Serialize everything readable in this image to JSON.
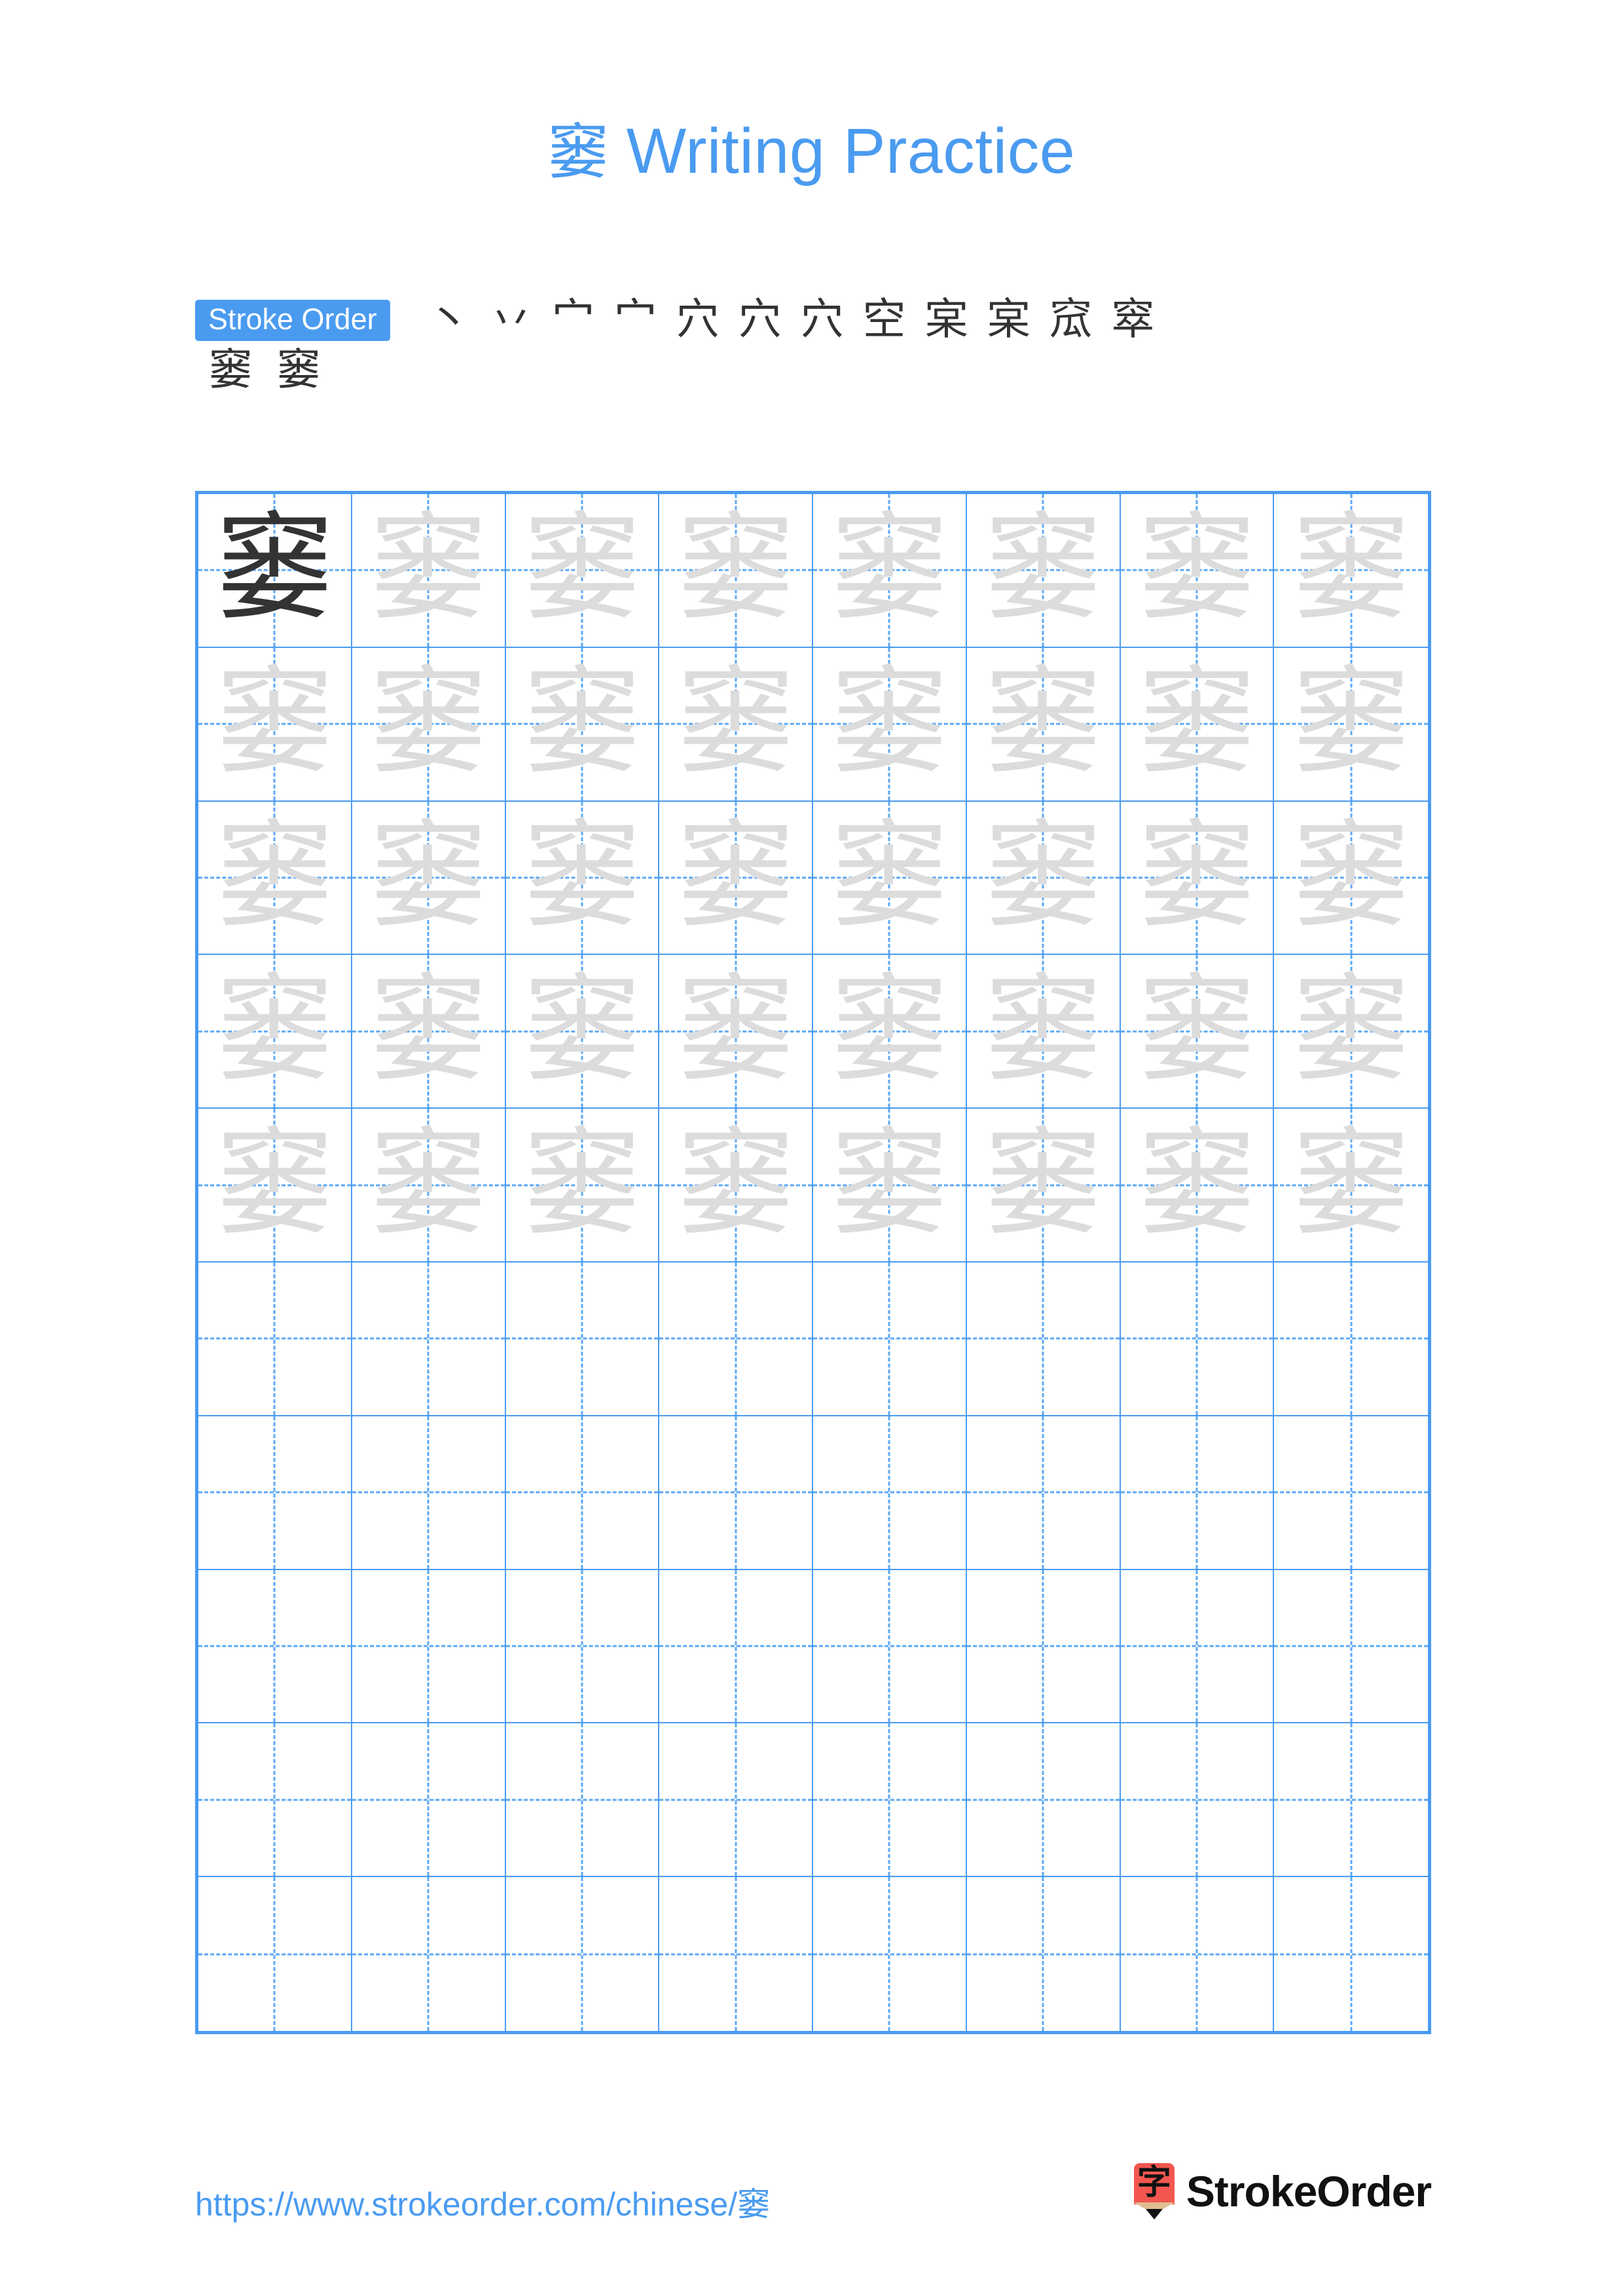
{
  "page": {
    "character": "窭",
    "title_suffix": " Writing Practice",
    "accent_color": "#4A9BF0",
    "ink_color": "#333333",
    "trace_color": "#dcdcdc"
  },
  "stroke_order": {
    "badge_label": "Stroke Order",
    "stroke_count": 14,
    "row1": [
      "丶",
      "丷",
      "宀",
      "宀",
      "穴",
      "穴",
      "穴",
      "空",
      "宲",
      "宲",
      "窊",
      "窣"
    ],
    "row2": [
      "窭",
      "窭"
    ]
  },
  "grid": {
    "columns": 8,
    "rows": 10,
    "filled_rows": 5,
    "empty_rows": 5,
    "model_cell_index": 0,
    "model_char": "窭",
    "trace_char": "窭"
  },
  "footer": {
    "url": "https://www.strokeorder.com/chinese/窭",
    "logo_glyph": "字",
    "logo_text": "StrokeOrder"
  }
}
